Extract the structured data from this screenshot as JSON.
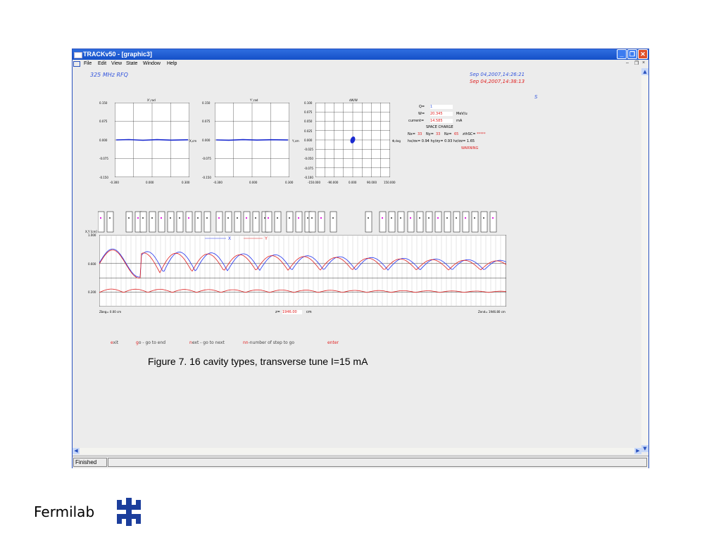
{
  "window": {
    "title": "TRACKv50 - [graphic3]",
    "menu": [
      "File",
      "Edit",
      "View",
      "State",
      "Window",
      "Help"
    ]
  },
  "header": {
    "label": "325 MHz RFQ",
    "date1": "Sep 04,2007,14:26:21",
    "date2": "Sep 04,2007,14:38:13",
    "s": "S"
  },
  "plots": [
    {
      "title": "X',rad",
      "axis": "X,cm",
      "yticks": [
        "0.150",
        "0.075",
        "0.000",
        "-0.075",
        "-0.150"
      ],
      "xticks": [
        "-0.300",
        "0.000",
        "0.300"
      ]
    },
    {
      "title": "Y',rad",
      "axis": "Y,cm",
      "yticks": [
        "0.150",
        "0.075",
        "0.000",
        "-0.075",
        "-0.150"
      ],
      "xticks": [
        "-0.300",
        "0.000",
        "0.300"
      ]
    },
    {
      "title": "dW/W",
      "axis": "Φ,deg",
      "yticks": [
        "0.100",
        "0.075",
        "0.050",
        "0.025",
        "0.000",
        "-0.025",
        "-0.050",
        "-0.075",
        "-0.100"
      ],
      "xticks": [
        "-150.000",
        "-90.000",
        "0.000",
        "90.000",
        "150.000"
      ]
    }
  ],
  "info": {
    "q_label": "Q=",
    "q_value": "1",
    "w_label": "W=",
    "w_value": "20.345",
    "w_unit": "MeV/u",
    "current_label": "current=",
    "current_value": "14.585",
    "current_unit": "mA",
    "space_charge": "SPACE CHARGE",
    "nx_label": "Nx=",
    "nx_value": "33",
    "ny_label": "Ny=",
    "ny_value": "33",
    "nz_label": "Nz=",
    "nz_value": "65",
    "zsc_label": "zthSC=",
    "zsc_value": "*****",
    "ratios": "hx/σx=  0.94  hy/σy=  0.93  hz/σz=  1.65",
    "warning": "WARNING"
  },
  "envelope": {
    "ylabel": "X,Y [cm]",
    "yticks": [
      "1.000",
      "0.600",
      "0.200"
    ],
    "legend_x": "X",
    "legend_y": "Y",
    "zbeg": "Zbeg=   0.00 cm",
    "z_label": "z=",
    "z_value": "1946.00",
    "z_unit": "cm",
    "zend": "Zend=   1946.80 cm"
  },
  "commands": [
    {
      "key": "e",
      "rest": "xit"
    },
    {
      "key": "g",
      "rest": "o - go to end"
    },
    {
      "key": "n",
      "rest": "ext - go to next"
    },
    {
      "key": "nn",
      "rest": "-number of step to go"
    },
    {
      "key": "enter",
      "rest": ""
    }
  ],
  "status": {
    "text": "Finished"
  },
  "caption": "Figure 7. 16 cavity types, transverse tune I=15 mA",
  "footer": {
    "brand": "Fermilab"
  },
  "colors": {
    "titlebar": "#1f5fd8",
    "series_x": "#2233ee",
    "series_y": "#e02020",
    "accent_red": "#e02020",
    "accent_blue": "#3355dd"
  }
}
